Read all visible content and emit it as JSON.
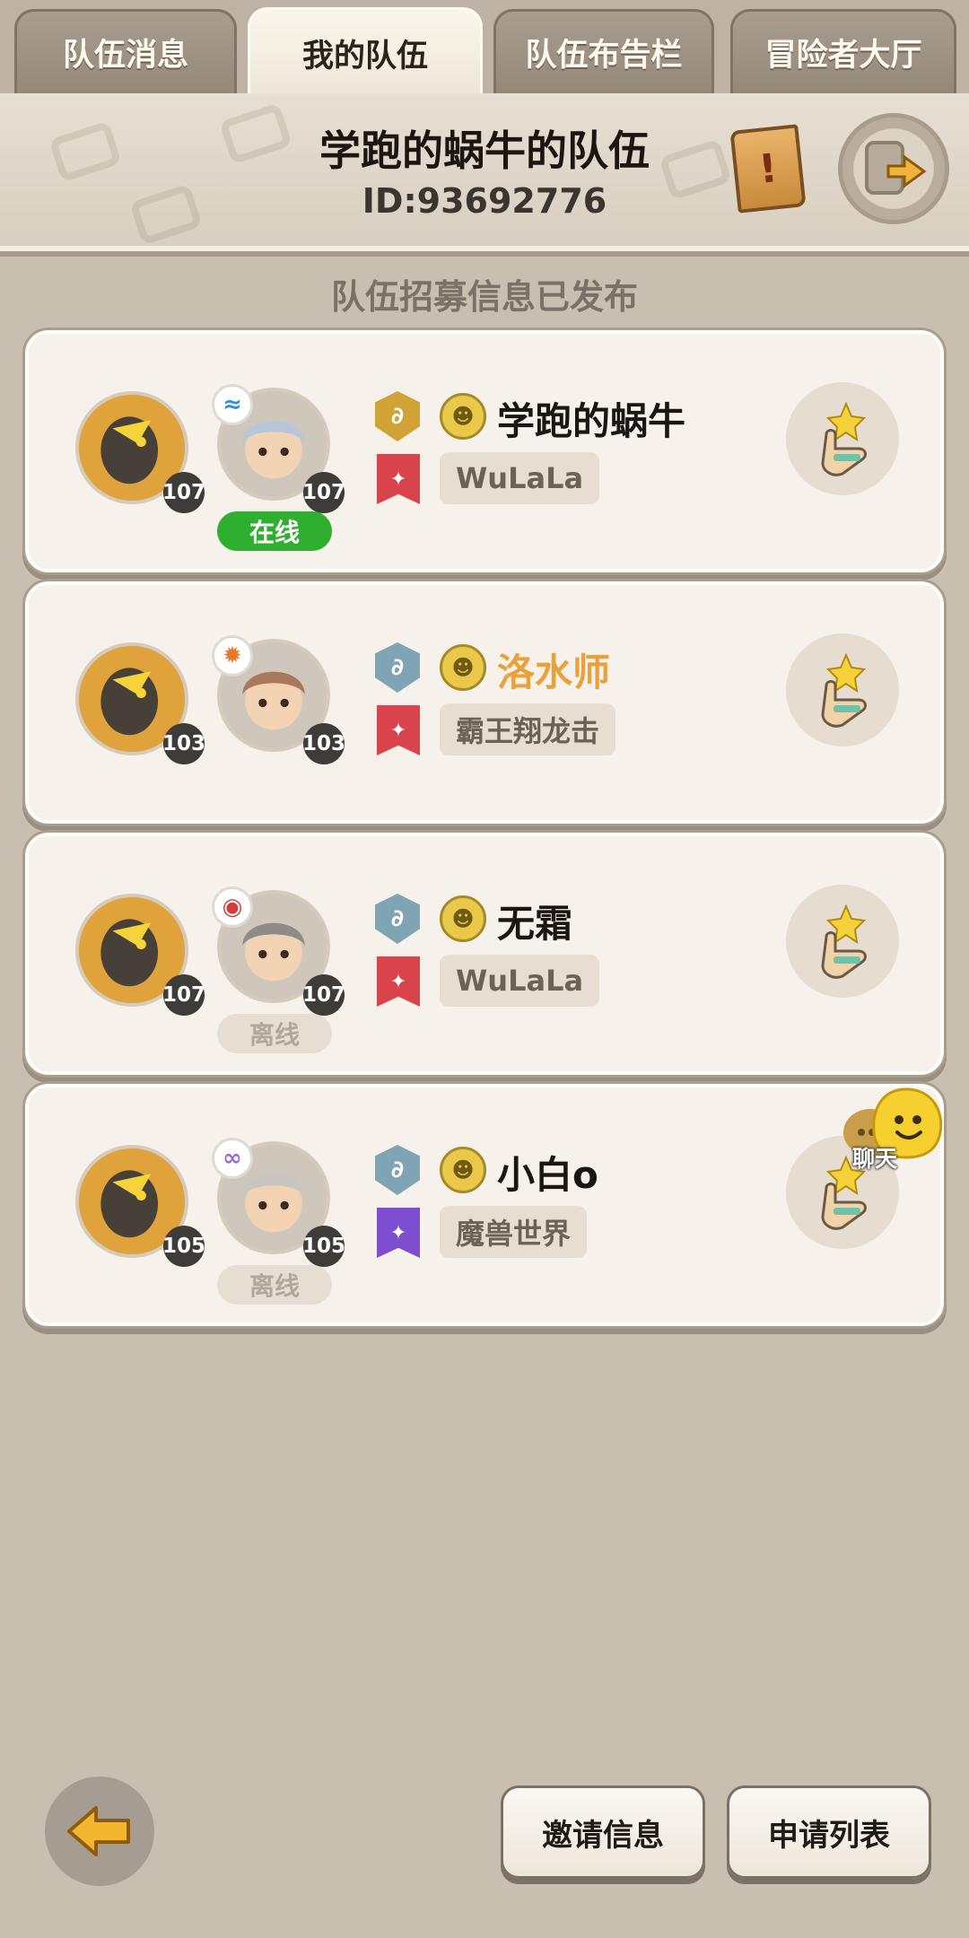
{
  "tabs": [
    "队伍消息",
    "我的队伍",
    "队伍布告栏",
    "冒险者大厅"
  ],
  "active_tab": 1,
  "team": {
    "name": "学跑的蜗牛的队伍",
    "id_text": "ID:93692776"
  },
  "recruit_status": "队伍招募信息已发布",
  "members": [
    {
      "name": "学跑的蜗牛",
      "name_color": "#1b1612",
      "guild": "WuLaLa",
      "pet_level": "107",
      "char_level": "107",
      "status": "在线",
      "element": "water",
      "rank": "gold",
      "banner": "red",
      "pet_color": "#e0a23a",
      "char_color": "#b7c7d9"
    },
    {
      "name": "洛水师",
      "name_color": "#e9a23a",
      "guild": "霸王翔龙击",
      "pet_level": "103",
      "char_level": "103",
      "status": "",
      "element": "fire",
      "rank": "blue",
      "banner": "red",
      "pet_color": "#e0a23a",
      "char_color": "#a9785a"
    },
    {
      "name": "无霜",
      "name_color": "#1b1612",
      "guild": "WuLaLa",
      "pet_level": "107",
      "char_level": "107",
      "status": "离线",
      "element": "demon",
      "rank": "blue",
      "banner": "red",
      "pet_color": "#e0a23a",
      "char_color": "#8f8b86"
    },
    {
      "name": "小白o",
      "name_color": "#1b1612",
      "guild": "魔兽世界",
      "pet_level": "105",
      "char_level": "105",
      "status": "离线",
      "element": "psychic",
      "rank": "blue",
      "banner": "purple",
      "pet_color": "#e0a23a",
      "char_color": "#c9c6c2"
    }
  ],
  "chat_label": "聊天",
  "buttons": {
    "invite": "邀请信息",
    "apply_list": "申请列表"
  }
}
